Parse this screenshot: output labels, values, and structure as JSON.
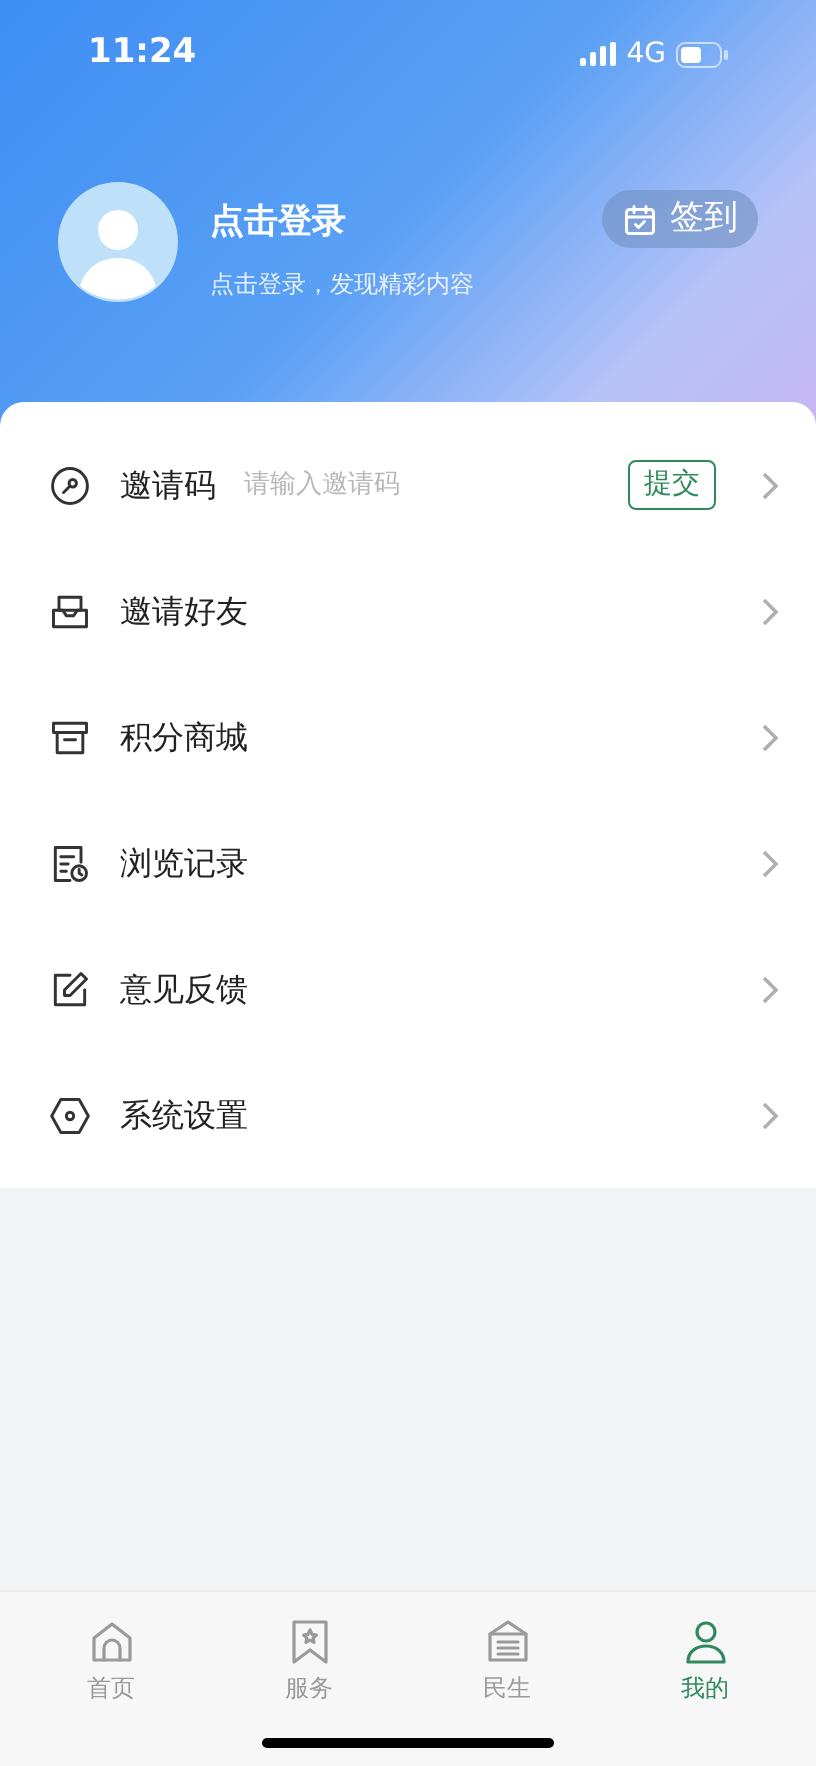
{
  "status_bar": {
    "time": "11:24",
    "network": "4G"
  },
  "profile": {
    "name": "点击登录",
    "subtitle": "点击登录，发现精彩内容",
    "checkin_button": "签到"
  },
  "menu": [
    {
      "kind": "code",
      "label": "邀请码",
      "placeholder": "请输入邀请码",
      "button": "提交"
    },
    {
      "kind": "link",
      "label": "邀请好友"
    },
    {
      "kind": "link",
      "label": "积分商城"
    },
    {
      "kind": "link",
      "label": "浏览记录"
    },
    {
      "kind": "link",
      "label": "意见反馈"
    },
    {
      "kind": "link",
      "label": "系统设置"
    }
  ],
  "tabs": [
    {
      "label": "首页",
      "selected": false
    },
    {
      "label": "服务",
      "selected": false
    },
    {
      "label": "民生",
      "selected": false
    },
    {
      "label": "我的",
      "selected": true
    }
  ]
}
